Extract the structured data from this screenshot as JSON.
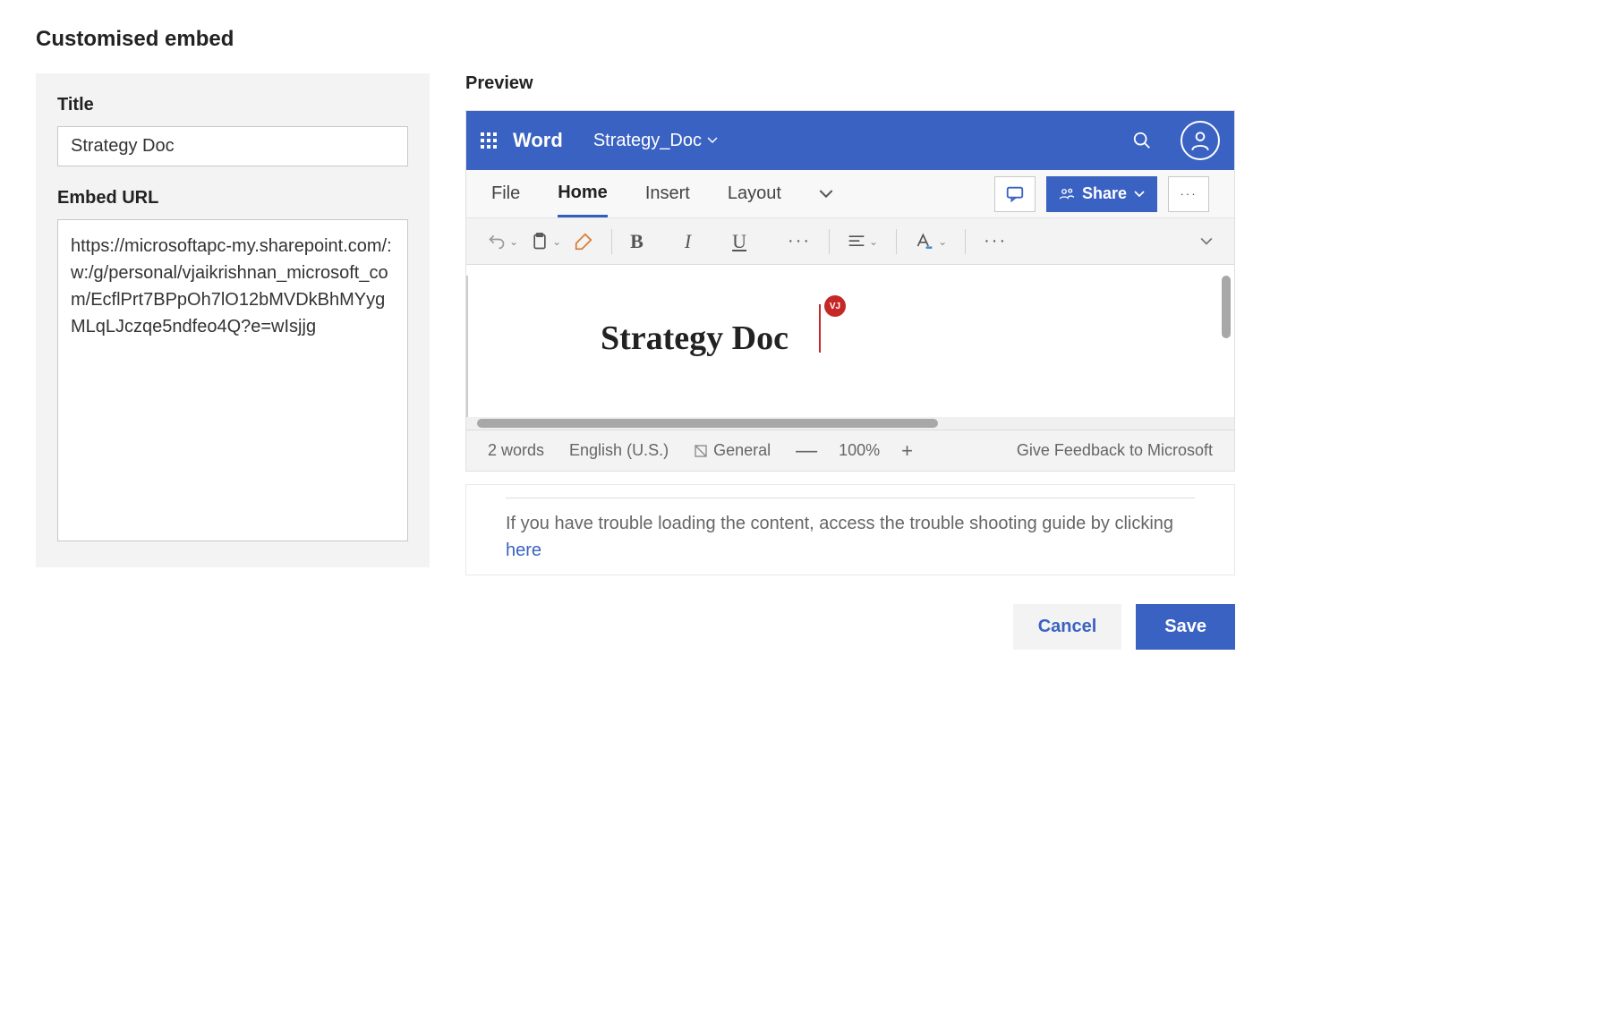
{
  "modal": {
    "title": "Customised embed"
  },
  "left": {
    "title_label": "Title",
    "title_value": "Strategy Doc",
    "url_label": "Embed URL",
    "url_value": "https://microsoftapc-my.sharepoint.com/:w:/g/personal/vjaikrishnan_microsoft_com/EcflPrt7BPpOh7lO12bMVDkBhMYygMLqLJczqe5ndfeo4Q?e=wIsjjg"
  },
  "preview": {
    "label": "Preview",
    "word_brand": "Word",
    "doc_name": "Strategy_Doc",
    "tabs": {
      "file": "File",
      "home": "Home",
      "insert": "Insert",
      "layout": "Layout"
    },
    "share_label": "Share",
    "document_text": "Strategy Doc",
    "presence_initials": "VJ",
    "status": {
      "word_count": "2 words",
      "language": "English (U.S.)",
      "sensitivity": "General",
      "zoom": "100%",
      "feedback": "Give Feedback to Microsoft"
    }
  },
  "help": {
    "text_prefix": "If you have trouble loading the content, access the trouble shooting guide by clicking ",
    "link_text": "here"
  },
  "footer": {
    "cancel": "Cancel",
    "save": "Save"
  }
}
